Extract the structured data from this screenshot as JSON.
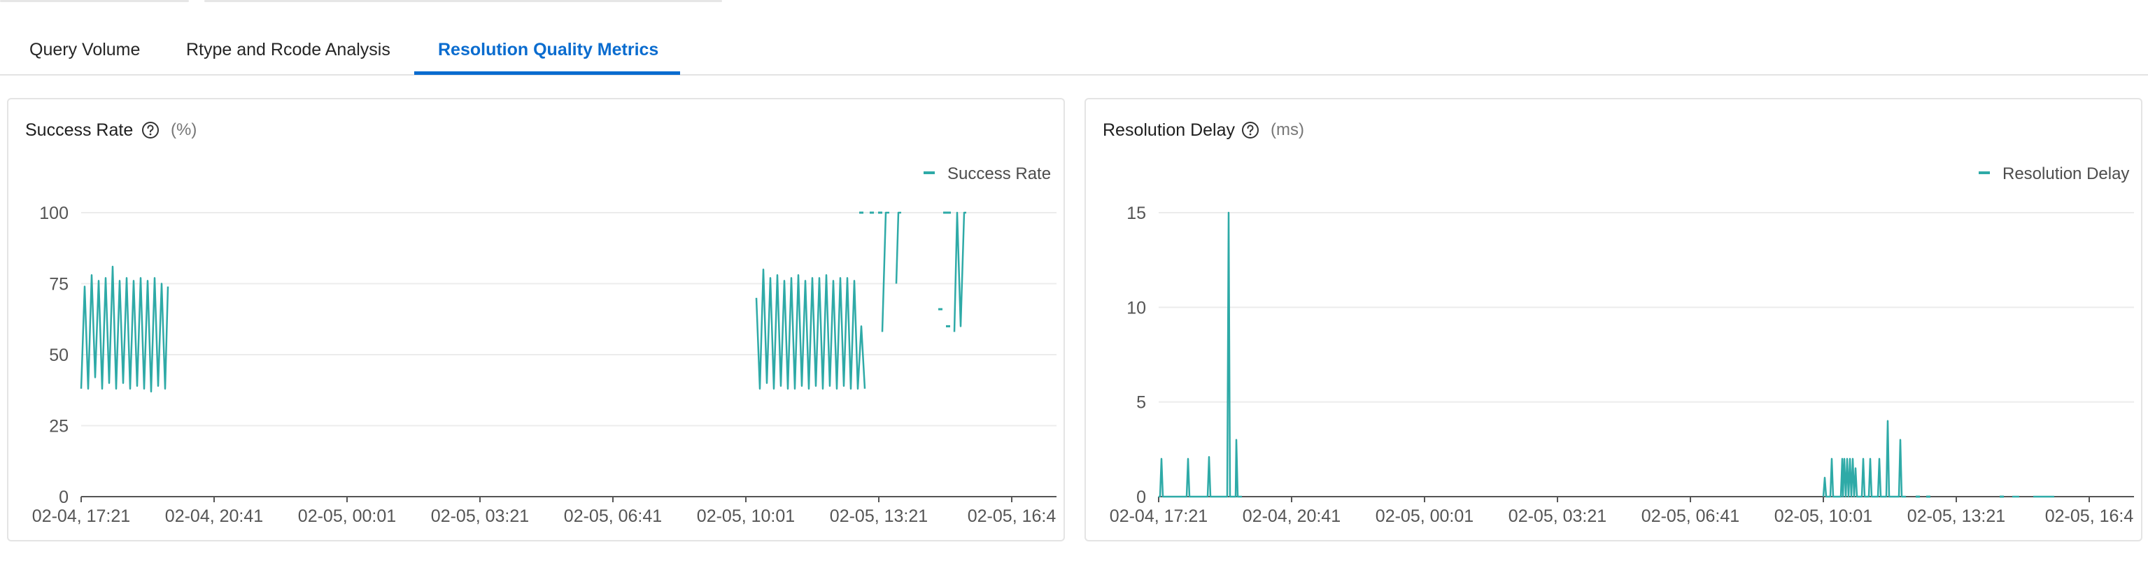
{
  "tabs": [
    {
      "label": "Query Volume",
      "active": false
    },
    {
      "label": "Rtype and Rcode Analysis",
      "active": false
    },
    {
      "label": "Resolution Quality Metrics",
      "active": true
    }
  ],
  "colors": {
    "accent": "#0a6ccf",
    "series": "#2eaaa7",
    "grid": "#ececec"
  },
  "icons": {
    "help": "question-circle-icon"
  },
  "panels": [
    {
      "title": "Success Rate",
      "unit": "(%)",
      "legend": "Success Rate"
    },
    {
      "title": "Resolution Delay",
      "unit": "(ms)",
      "legend": "Resolution Delay"
    }
  ],
  "chart_data": [
    {
      "type": "line",
      "title": "Success Rate",
      "unit": "(%)",
      "x_tick_labels": [
        "02-04, 17:21",
        "02-04, 20:41",
        "02-05, 00:01",
        "02-05, 03:21",
        "02-05, 06:41",
        "02-05, 10:01",
        "02-05, 13:21",
        "02-05, 16:4"
      ],
      "y_ticks": [
        0,
        25,
        50,
        75,
        100
      ],
      "ylim": [
        0,
        100
      ],
      "grid": true,
      "legend_position": "top-right",
      "series": [
        {
          "name": "Success Rate",
          "segments": [
            [
              [
                0,
                38
              ],
              [
                5,
                74
              ],
              [
                10,
                38
              ],
              [
                15,
                78
              ],
              [
                20,
                42
              ],
              [
                25,
                76
              ],
              [
                30,
                38
              ],
              [
                35,
                77
              ],
              [
                40,
                40
              ],
              [
                45,
                81
              ],
              [
                50,
                38
              ],
              [
                55,
                76
              ],
              [
                60,
                40
              ],
              [
                65,
                77
              ],
              [
                70,
                38
              ],
              [
                75,
                76
              ],
              [
                80,
                39
              ],
              [
                85,
                77
              ],
              [
                90,
                38
              ],
              [
                95,
                76
              ],
              [
                100,
                37
              ],
              [
                105,
                77
              ],
              [
                110,
                39
              ],
              [
                115,
                75
              ],
              [
                120,
                38
              ],
              [
                124,
                74
              ]
            ],
            [
              [
                965,
                70
              ],
              [
                970,
                38
              ],
              [
                975,
                80
              ],
              [
                980,
                40
              ],
              [
                985,
                77
              ],
              [
                990,
                38
              ],
              [
                995,
                78
              ],
              [
                1000,
                39
              ],
              [
                1005,
                76
              ],
              [
                1010,
                38
              ],
              [
                1015,
                77
              ],
              [
                1020,
                38
              ],
              [
                1025,
                78
              ],
              [
                1030,
                39
              ],
              [
                1035,
                76
              ],
              [
                1040,
                38
              ],
              [
                1045,
                77
              ],
              [
                1050,
                39
              ],
              [
                1055,
                77
              ],
              [
                1060,
                38
              ],
              [
                1065,
                78
              ],
              [
                1070,
                39
              ],
              [
                1075,
                76
              ],
              [
                1080,
                38
              ],
              [
                1085,
                77
              ],
              [
                1090,
                39
              ],
              [
                1095,
                77
              ],
              [
                1100,
                38
              ],
              [
                1105,
                76
              ],
              [
                1110,
                38
              ],
              [
                1115,
                60
              ],
              [
                1120,
                38
              ]
            ],
            [
              [
                1145,
                58
              ],
              [
                1150,
                100
              ],
              [
                1155,
                100
              ]
            ],
            [
              [
                1165,
                75
              ],
              [
                1168,
                100
              ],
              [
                1172,
                100
              ]
            ],
            [
              [
                1248,
                58
              ],
              [
                1252,
                100
              ],
              [
                1257,
                60
              ],
              [
                1262,
                100
              ],
              [
                1265,
                100
              ]
            ]
          ],
          "dots": [
            [
              1115,
              100
            ],
            [
              1130,
              100
            ],
            [
              1142,
              100
            ],
            [
              1235,
              100
            ],
            [
              1240,
              100
            ],
            [
              1228,
              66
            ],
            [
              1239,
              60
            ]
          ]
        }
      ]
    },
    {
      "type": "line",
      "title": "Resolution Delay",
      "unit": "(ms)",
      "x_tick_labels": [
        "02-04, 17:21",
        "02-04, 20:41",
        "02-05, 00:01",
        "02-05, 03:21",
        "02-05, 06:41",
        "02-05, 10:01",
        "02-05, 13:21",
        "02-05, 16:4"
      ],
      "y_ticks": [
        0,
        5,
        10,
        15
      ],
      "ylim": [
        0,
        15
      ],
      "grid": true,
      "legend_position": "top-right",
      "series": [
        {
          "name": "Resolution Delay",
          "segments": [
            [
              [
                0,
                0
              ],
              [
                2,
                0
              ],
              [
                4,
                2
              ],
              [
                6,
                0
              ],
              [
                40,
                0
              ],
              [
                42,
                2
              ],
              [
                44,
                0
              ],
              [
                70,
                0
              ],
              [
                72,
                2.1
              ],
              [
                74,
                0
              ],
              [
                98,
                0
              ],
              [
                100,
                15
              ],
              [
                102,
                0
              ],
              [
                110,
                0
              ],
              [
                111,
                3
              ],
              [
                113,
                0
              ],
              [
                119,
                0
              ]
            ],
            [
              [
                950,
                0
              ],
              [
                952,
                1
              ],
              [
                954,
                0
              ],
              [
                960,
                0
              ],
              [
                962,
                2
              ],
              [
                964,
                0
              ],
              [
                975,
                0
              ],
              [
                977,
                2
              ],
              [
                978,
                0
              ],
              [
                980,
                2
              ],
              [
                982,
                0
              ],
              [
                984,
                2
              ],
              [
                986,
                0
              ],
              [
                988,
                2
              ],
              [
                990,
                0
              ],
              [
                992,
                2
              ],
              [
                994,
                0
              ],
              [
                996,
                1.5
              ],
              [
                998,
                0
              ],
              [
                1005,
                0
              ],
              [
                1007,
                2
              ],
              [
                1009,
                0
              ],
              [
                1015,
                0
              ],
              [
                1017,
                2
              ],
              [
                1019,
                0
              ],
              [
                1028,
                0
              ],
              [
                1030,
                2
              ],
              [
                1032,
                0
              ],
              [
                1040,
                0
              ],
              [
                1042,
                4
              ],
              [
                1044,
                0
              ],
              [
                1058,
                0
              ],
              [
                1060,
                3
              ],
              [
                1062,
                0
              ],
              [
                1068,
                0
              ]
            ],
            [
              [
                1220,
                0
              ],
              [
                1230,
                0
              ]
            ],
            [
              [
                1250,
                0
              ],
              [
                1280,
                0
              ]
            ]
          ],
          "dots": [
            [
              1085,
              0
            ],
            [
              1100,
              0
            ],
            [
              1205,
              0
            ]
          ]
        }
      ]
    }
  ]
}
